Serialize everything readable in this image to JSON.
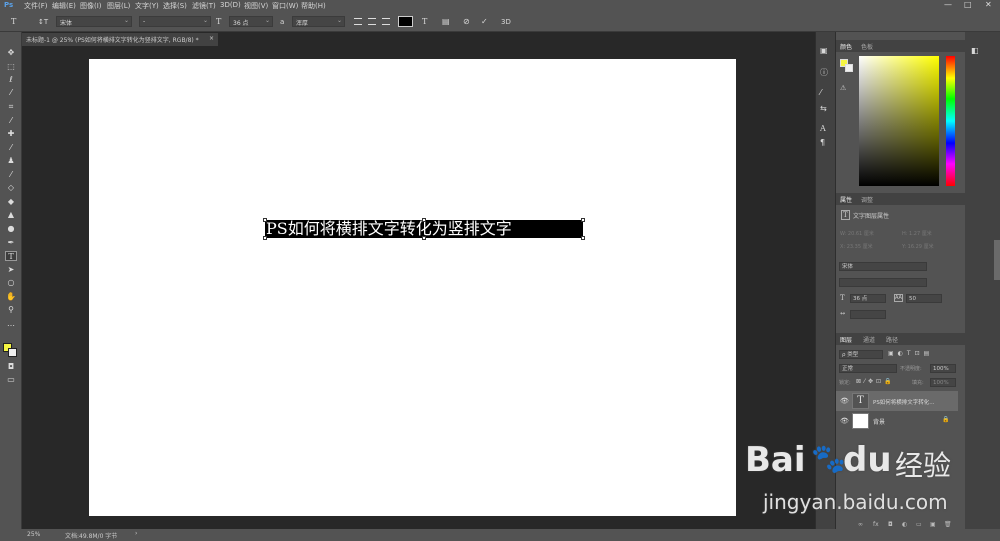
{
  "menu": {
    "items": [
      "文件(F)",
      "编辑(E)",
      "图像(I)",
      "图层(L)",
      "文字(Y)",
      "选择(S)",
      "滤镜(T)",
      "3D(D)",
      "视图(V)",
      "窗口(W)",
      "帮助(H)"
    ],
    "window_controls": {
      "minimize": "—",
      "maximize": "□",
      "close": "✕"
    }
  },
  "options": {
    "tool_icon": "T",
    "orient_icon": "↕T",
    "font_family": "宋体",
    "font_style": "-",
    "size_icon": "T",
    "font_size": "36 点",
    "aa_icon": "a",
    "antialias": "浑厚",
    "warp_icon": "T",
    "panel_icon": "▤",
    "cancel_icon": "⊘",
    "commit_icon": "✓",
    "threed": "3D",
    "text_color": "#000000"
  },
  "document": {
    "tab_title": "未标题-1 @ 25% (PS如何将横排文字转化为竖排文字, RGB/8) *",
    "close": "×",
    "text": "PS如何将横排文字转化为竖排文字"
  },
  "status": {
    "zoom": "25%",
    "doc_info": "文档:49.8M/0 字节",
    "arrow": "›"
  },
  "color_panel": {
    "tab_color": "颜色",
    "tab_swatches": "色板",
    "foreground": "#f5f542",
    "background": "#f0f0f0"
  },
  "properties_panel": {
    "tab_properties": "属性",
    "tab_adjust": "调整",
    "header": "文字图层属性",
    "w": "W: 20.61 厘米",
    "h": "H: 1.27 厘米",
    "x": "X: 23.35 厘米",
    "y": "Y: 16.29 厘米",
    "font": "宋体",
    "size": "36 点",
    "leading": "50",
    "tracking": ""
  },
  "layers_panel": {
    "tabs": [
      "图层",
      "通道",
      "路径"
    ],
    "kind": "ρ 类型",
    "blend": "正常",
    "opacity_label": "不透明度:",
    "opacity": "100%",
    "lock_label": "锁定:",
    "fill_label": "填充:",
    "fill": "100%",
    "layers": [
      {
        "name": "PS如何将横排文字转化...",
        "type_icon": "T"
      },
      {
        "name": "背景",
        "lock_icon": "🔒"
      }
    ],
    "footer_icons": [
      "∞",
      "fx",
      "◘",
      "◐",
      "▭",
      "▣",
      "🗑"
    ]
  },
  "watermark": {
    "brand": "Bai",
    "brand2": "du",
    "cn": "经验",
    "url": "jingyan.baidu.com"
  }
}
